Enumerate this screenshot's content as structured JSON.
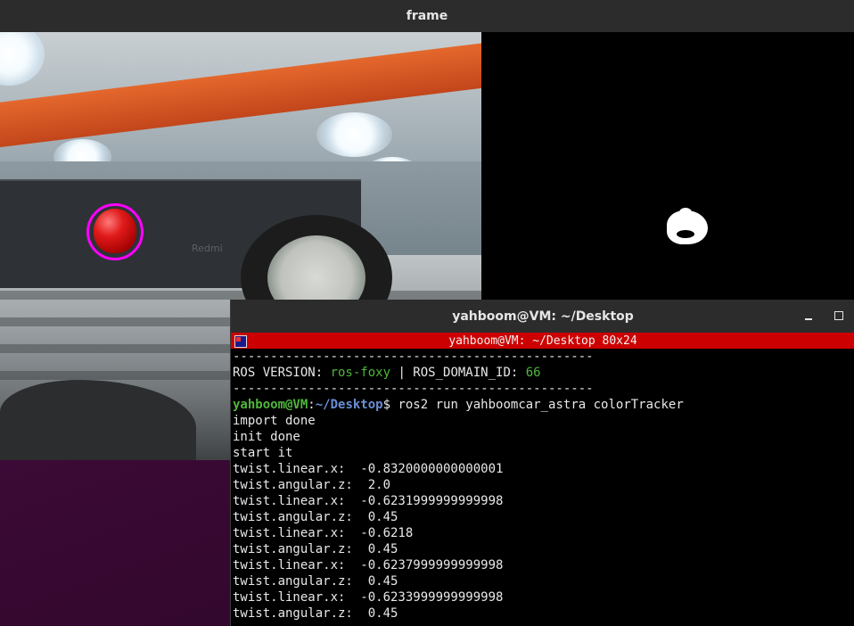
{
  "frame_window": {
    "title": "frame"
  },
  "camera": {
    "watermark": "Redmi"
  },
  "terminal": {
    "title": "yahboom@VM: ~/Desktop",
    "tab_label": "yahboom@VM: ~/Desktop 80x24",
    "separator": "------------------------------------------------",
    "ros_version_label": "ROS VERSION: ",
    "ros_version_value": "ros-foxy",
    "ros_domain_label": " | ROS_DOMAIN_ID: ",
    "ros_domain_value": "66",
    "prompt_user": "yahboom@VM",
    "prompt_sep": ":",
    "prompt_path": "~/Desktop",
    "prompt_dollar": "$ ",
    "command": "ros2 run yahboomcar_astra colorTracker",
    "lines": [
      "import done",
      "init done",
      "start it",
      "twist.linear.x:  -0.8320000000000001",
      "twist.angular.z:  2.0",
      "twist.linear.x:  -0.6231999999999998",
      "twist.angular.z:  0.45",
      "twist.linear.x:  -0.6218",
      "twist.angular.z:  0.45",
      "twist.linear.x:  -0.6237999999999998",
      "twist.angular.z:  0.45",
      "twist.linear.x:  -0.6233999999999998",
      "twist.angular.z:  0.45"
    ]
  },
  "colors": {
    "titlebar": "#2c2c2c",
    "tab_bar": "#cc0000",
    "tracking_circle": "#ff00ff",
    "prompt_green": "#4fb83a",
    "prompt_blue": "#6a8fd6"
  }
}
